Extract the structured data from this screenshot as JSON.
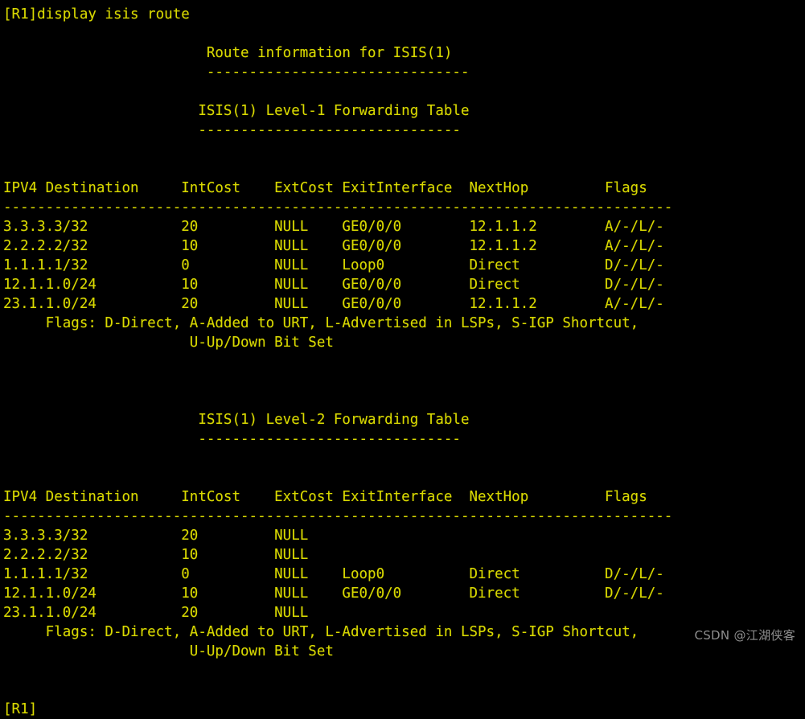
{
  "terminal": {
    "colors": {
      "background": "#000000",
      "text": "#d9d900",
      "watermark": "#8e8e8e"
    },
    "prompt_top": "[R1]display isis route",
    "prompt_bottom": "[R1]",
    "command": "display isis route",
    "device": "R1",
    "report_title": "Route information for ISIS(1)",
    "report_title_rule": "-------------------------------",
    "flags_legend_line1": "Flags: D-Direct, A-Added to URT, L-Advertised in LSPs, S-IGP Shortcut,",
    "flags_legend_line2": "U-Up/Down Bit Set",
    "table_rule": "-------------------------------------------------------------------------------",
    "section_rule": "-------------------------------",
    "columns": {
      "destination": "IPV4 Destination",
      "intcost": "IntCost",
      "extcost": "ExtCost",
      "exitinterface": "ExitInterface",
      "nexthop": "NextHop",
      "flags": "Flags"
    },
    "tables": [
      {
        "title": "ISIS(1) Level-1 Forwarding Table",
        "level": "Level-1",
        "rows": [
          {
            "destination": "3.3.3.3/32",
            "intcost": "20",
            "extcost": "NULL",
            "exitinterface": "GE0/0/0",
            "nexthop": "12.1.1.2",
            "flags": "A/-/L/-"
          },
          {
            "destination": "2.2.2.2/32",
            "intcost": "10",
            "extcost": "NULL",
            "exitinterface": "GE0/0/0",
            "nexthop": "12.1.1.2",
            "flags": "A/-/L/-"
          },
          {
            "destination": "1.1.1.1/32",
            "intcost": "0",
            "extcost": "NULL",
            "exitinterface": "Loop0",
            "nexthop": "Direct",
            "flags": "D/-/L/-"
          },
          {
            "destination": "12.1.1.0/24",
            "intcost": "10",
            "extcost": "NULL",
            "exitinterface": "GE0/0/0",
            "nexthop": "Direct",
            "flags": "D/-/L/-"
          },
          {
            "destination": "23.1.1.0/24",
            "intcost": "20",
            "extcost": "NULL",
            "exitinterface": "GE0/0/0",
            "nexthop": "12.1.1.2",
            "flags": "A/-/L/-"
          }
        ]
      },
      {
        "title": "ISIS(1) Level-2 Forwarding Table",
        "level": "Level-2",
        "rows": [
          {
            "destination": "3.3.3.3/32",
            "intcost": "20",
            "extcost": "NULL",
            "exitinterface": "",
            "nexthop": "",
            "flags": ""
          },
          {
            "destination": "2.2.2.2/32",
            "intcost": "10",
            "extcost": "NULL",
            "exitinterface": "",
            "nexthop": "",
            "flags": ""
          },
          {
            "destination": "1.1.1.1/32",
            "intcost": "0",
            "extcost": "NULL",
            "exitinterface": "Loop0",
            "nexthop": "Direct",
            "flags": "D/-/L/-"
          },
          {
            "destination": "12.1.1.0/24",
            "intcost": "10",
            "extcost": "NULL",
            "exitinterface": "GE0/0/0",
            "nexthop": "Direct",
            "flags": "D/-/L/-"
          },
          {
            "destination": "23.1.1.0/24",
            "intcost": "20",
            "extcost": "NULL",
            "exitinterface": "",
            "nexthop": "",
            "flags": ""
          }
        ]
      }
    ],
    "watermark": "CSDN @江湖侠客"
  }
}
